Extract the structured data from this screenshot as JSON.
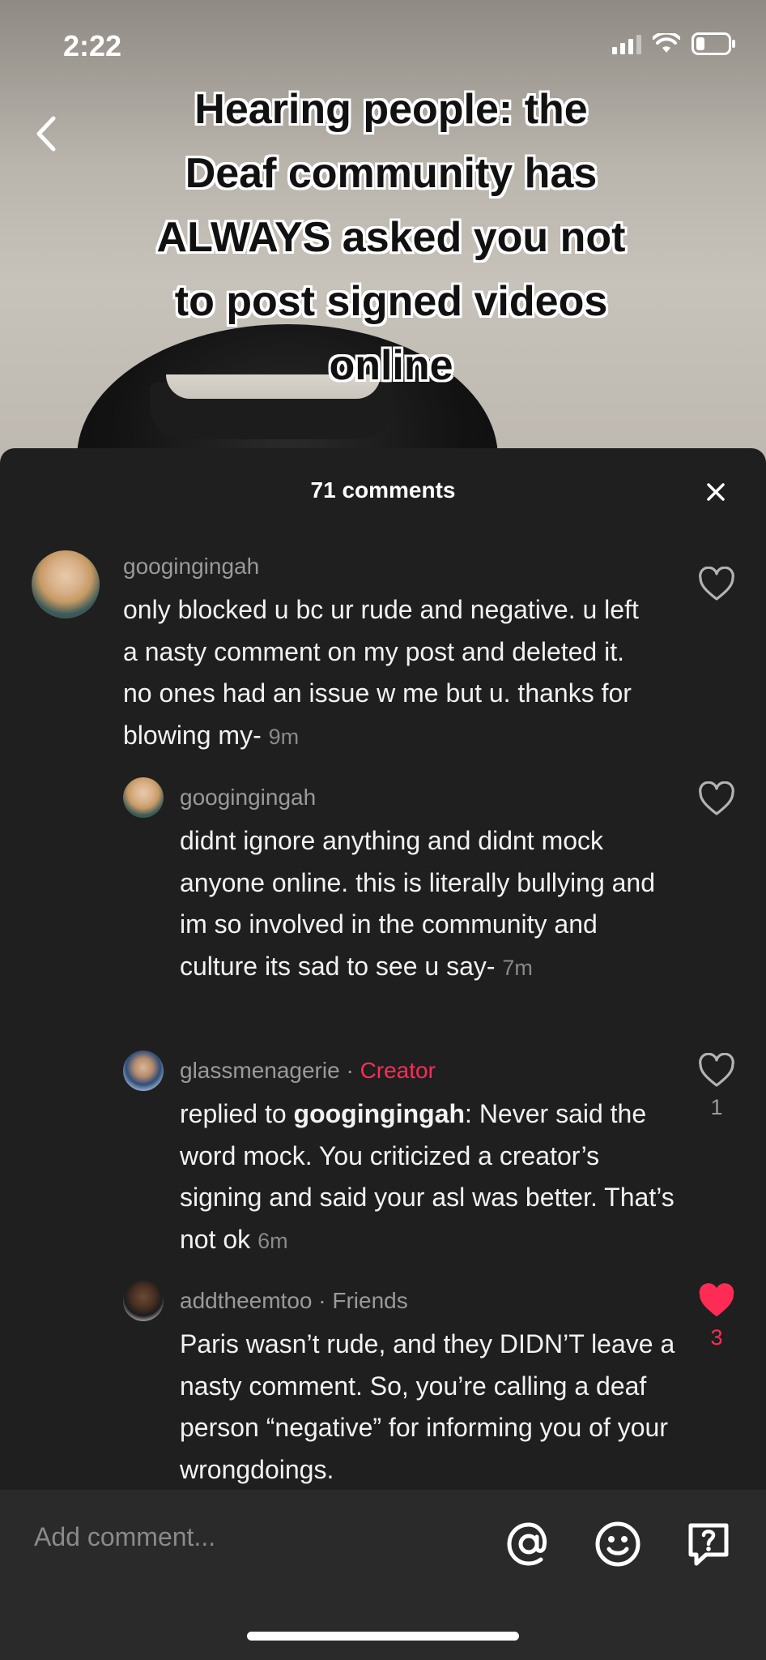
{
  "status_bar": {
    "time": "2:22"
  },
  "video": {
    "caption_lines": [
      "Hearing people: the",
      "Deaf community has",
      "ALWAYS asked you not",
      "to post signed videos",
      "online"
    ]
  },
  "comments_panel": {
    "title": "71 comments",
    "comments": [
      {
        "username": "googingingah",
        "text": "only blocked u bc ur rude and negative. u left a nasty comment on my post and deleted it. no ones had an issue w me but u. thanks for blowing my-",
        "time": "9m",
        "likes": ""
      },
      {
        "username": "googingingah",
        "text": "didnt ignore anything and didnt mock anyone online. this is literally bullying and im so involved in the community and culture its sad to see u say-",
        "time": "7m",
        "likes": ""
      },
      {
        "username": "glassmenagerie",
        "badge_separator": "·",
        "badge": "Creator",
        "reply_prefix": "replied to",
        "reply_to": "googingingah",
        "text": ": Never said the word mock. You criticized a creator’s signing and said your asl was better. That’s not ok",
        "time": "6m",
        "likes": "1"
      },
      {
        "username": "addtheemtoo",
        "badge_separator": "·",
        "badge": "Friends",
        "text": "Paris wasn’t rude, and they DIDN’T leave a nasty comment. So, you’re calling a deaf person “negative” for informing you of your wrongdoings.",
        "likes": "3",
        "liked": true
      }
    ]
  },
  "input": {
    "placeholder": "Add comment..."
  },
  "colors": {
    "creator_badge": "#fe2c55",
    "liked_heart": "#fe2c55",
    "sheet_background": "#1f1f1f",
    "input_bar": "#2a2a2a"
  },
  "icons": [
    "back-chevron-icon",
    "close-icon",
    "heart-outline-icon",
    "heart-filled-icon",
    "mention-icon",
    "emoji-icon",
    "question-sticker-icon",
    "signal-icon",
    "wifi-icon",
    "battery-icon"
  ]
}
